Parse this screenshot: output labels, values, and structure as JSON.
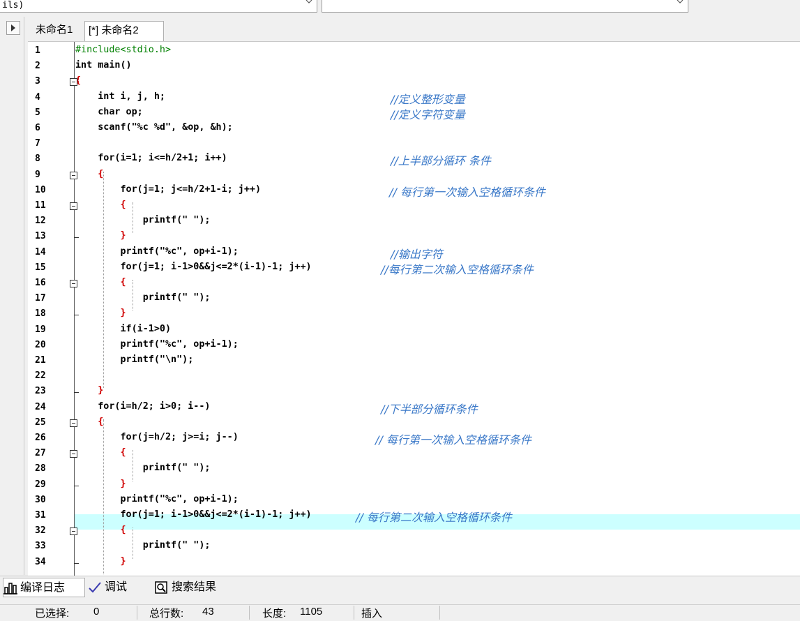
{
  "top": {
    "combo1_text": "ils)"
  },
  "tabs": {
    "tab1": "未命名1",
    "tab2": "[*] 未命名2"
  },
  "code_lines": [
    {
      "n": "1",
      "t": "#include<stdio.h>",
      "cls": "pp",
      "c": ""
    },
    {
      "n": "2",
      "t": "int main()",
      "cls": "",
      "c": ""
    },
    {
      "n": "3",
      "t": "{",
      "cls": "sym",
      "c": ""
    },
    {
      "n": "4",
      "t": "    int i, j, h;",
      "cls": "",
      "c": "//定义整形变量"
    },
    {
      "n": "5",
      "t": "    char op;",
      "cls": "",
      "c": "//定义字符变量"
    },
    {
      "n": "6",
      "t": "    scanf(\"%c %d\", &op, &h);",
      "cls": "",
      "c": ""
    },
    {
      "n": "7",
      "t": "",
      "cls": "",
      "c": ""
    },
    {
      "n": "8",
      "t": "    for(i=1; i<=h/2+1; i++)",
      "cls": "",
      "c": "//上半部分循环 条件"
    },
    {
      "n": "9",
      "t": "    {",
      "cls": "sym",
      "c": ""
    },
    {
      "n": "10",
      "t": "        for(j=1; j<=h/2+1-i; j++)",
      "cls": "",
      "c": "// 每行第一次输入空格循环条件"
    },
    {
      "n": "11",
      "t": "        {",
      "cls": "sym",
      "c": ""
    },
    {
      "n": "12",
      "t": "            printf(\" \");",
      "cls": "",
      "c": ""
    },
    {
      "n": "13",
      "t": "        }",
      "cls": "sym",
      "c": ""
    },
    {
      "n": "14",
      "t": "        printf(\"%c\", op+i-1);",
      "cls": "",
      "c": "//输出字符"
    },
    {
      "n": "15",
      "t": "        for(j=1; i-1>0&&j<=2*(i-1)-1; j++)",
      "cls": "",
      "c": "//每行第二次输入空格循环条件"
    },
    {
      "n": "16",
      "t": "        {",
      "cls": "sym",
      "c": ""
    },
    {
      "n": "17",
      "t": "            printf(\" \");",
      "cls": "",
      "c": ""
    },
    {
      "n": "18",
      "t": "        }",
      "cls": "sym",
      "c": ""
    },
    {
      "n": "19",
      "t": "        if(i-1>0)",
      "cls": "",
      "c": ""
    },
    {
      "n": "20",
      "t": "        printf(\"%c\", op+i-1);",
      "cls": "",
      "c": ""
    },
    {
      "n": "21",
      "t": "        printf(\"\\n\");",
      "cls": "",
      "c": ""
    },
    {
      "n": "22",
      "t": "",
      "cls": "",
      "c": ""
    },
    {
      "n": "23",
      "t": "    }",
      "cls": "sym",
      "c": ""
    },
    {
      "n": "24",
      "t": "    for(i=h/2; i>0; i--)",
      "cls": "",
      "c": "//下半部分循环条件"
    },
    {
      "n": "25",
      "t": "    {",
      "cls": "sym",
      "c": ""
    },
    {
      "n": "26",
      "t": "        for(j=h/2; j>=i; j--)",
      "cls": "",
      "c": "// 每行第一次输入空格循环条件"
    },
    {
      "n": "27",
      "t": "        {",
      "cls": "sym",
      "c": ""
    },
    {
      "n": "28",
      "t": "            printf(\" \");",
      "cls": "",
      "c": ""
    },
    {
      "n": "29",
      "t": "        }",
      "cls": "sym",
      "c": ""
    },
    {
      "n": "30",
      "t": "        printf(\"%c\", op+i-1);",
      "cls": "",
      "c": ""
    },
    {
      "n": "31",
      "t": "        for(j=1; i-1>0&&j<=2*(i-1)-1; j++)",
      "cls": "",
      "c": "// 每行第二次输入空格循环条件"
    },
    {
      "n": "32",
      "t": "        {",
      "cls": "sym",
      "c": ""
    },
    {
      "n": "33",
      "t": "            printf(\" \");",
      "cls": "",
      "c": ""
    },
    {
      "n": "34",
      "t": "        }",
      "cls": "sym",
      "c": ""
    }
  ],
  "bottom_tabs": {
    "compile_log": "编译日志",
    "debug": "调试",
    "search_results": "搜索结果"
  },
  "status": {
    "selected_label": "已选择:",
    "selected_value": "0",
    "total_lines_label": "总行数:",
    "total_lines_value": "43",
    "length_label": "长度:",
    "length_value": "1105",
    "mode": "插入"
  },
  "colors": {
    "keyword": "#000000",
    "preprocessor": "#008000",
    "string": "#0000ff",
    "number": "#8b0000",
    "symbol": "#d00000",
    "comment": "#3a78c8",
    "current_line": "#ccffff"
  }
}
